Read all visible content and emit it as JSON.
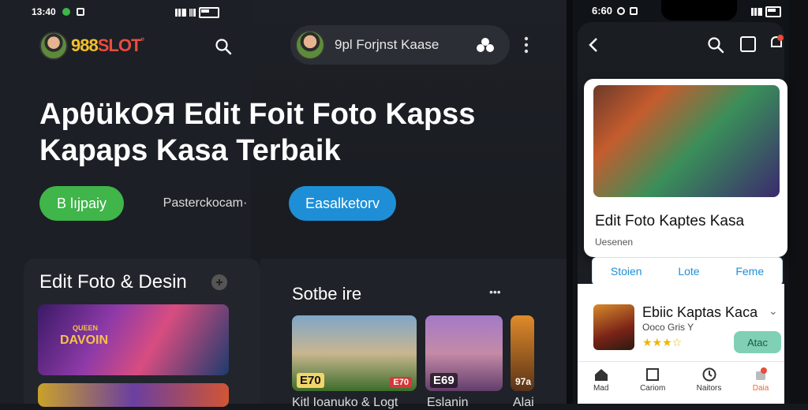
{
  "left_phone": {
    "status_time": "13:40",
    "logo_text_1": "988",
    "logo_text_2": "SLOT",
    "logo_text_3": "°"
  },
  "search": {
    "text": "9pl Forjnst Kaase"
  },
  "hero": {
    "line1": "ApθükOЯ Edit Foit Foto Kapss",
    "line2": "Kapaps Kasa Terbaik"
  },
  "buttons": {
    "green": "B lıjpaiy",
    "plain": "Pasterckocam·",
    "blue": "Easalketorv"
  },
  "section_left": {
    "title": "Edit Foto & Desin",
    "thumb_a_label": "DAVOIN",
    "thumb_a_tag": "QUEEN"
  },
  "section_mid": {
    "title": "Sotbe ire",
    "more": "•••",
    "thumb_c_badge": "E70",
    "thumb_c_badge2": "E70",
    "thumb_d_badge": "E69",
    "thumb_e_badge": "97a",
    "caption_1": "Kitl Ioanuko & Logt",
    "caption_2": "Eslanin",
    "caption_3": "Alai"
  },
  "right_phone": {
    "status_time": "6:60",
    "app_title": "Edit Foto Kaptes Kasa",
    "app_sub": "Uesenen",
    "tabs": [
      "Stoien",
      "Lote",
      "Feme"
    ],
    "list_title": "Ebiic Kaptas Kaca",
    "list_sub": "Ooco Gris Y",
    "stars": "★★★☆",
    "get_label": "Atac",
    "nav": [
      "Mad",
      "Cariom",
      "Naitors",
      "Daia"
    ]
  },
  "colors": {
    "green": "#3fb54a",
    "blue": "#1e8fd6",
    "logo_yellow": "#f2c02a",
    "logo_red": "#e84c3d",
    "active_nav": "#e86a2a"
  }
}
